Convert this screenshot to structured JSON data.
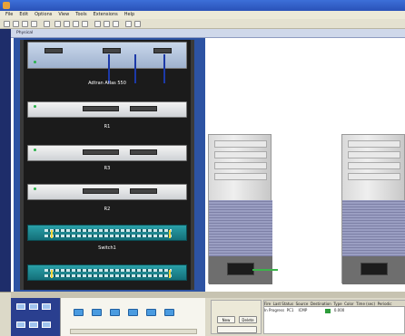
{
  "window": {
    "title": "",
    "menu": [
      "File",
      "Edit",
      "Options",
      "View",
      "Tools",
      "Extensions",
      "Help"
    ]
  },
  "physical_nav": {
    "tab_label": "Physical",
    "segments": [
      "",
      "",
      "",
      "",
      "",
      ""
    ]
  },
  "rack": {
    "device_labels": [
      "Adtran Atlas 550",
      "R1",
      "R3",
      "R2",
      "Switch1"
    ]
  },
  "bottom": {
    "tabs": [
      "",
      ""
    ],
    "hint": "",
    "sim_buttons": [
      "New",
      "Delete"
    ],
    "pdu_headers": [
      "Fire",
      "Last Status",
      "Source",
      "Destination",
      "Type",
      "Color",
      "Time (sec)",
      "Periodic"
    ],
    "pdu_row": {
      "status": "In Progress",
      "source": "PC1",
      "destination": "",
      "type": "ICMP",
      "time": "0.000"
    }
  },
  "colors": {
    "accent": "#2d53a3",
    "switch": "#1d8a93",
    "link_up": "#29b34a"
  }
}
